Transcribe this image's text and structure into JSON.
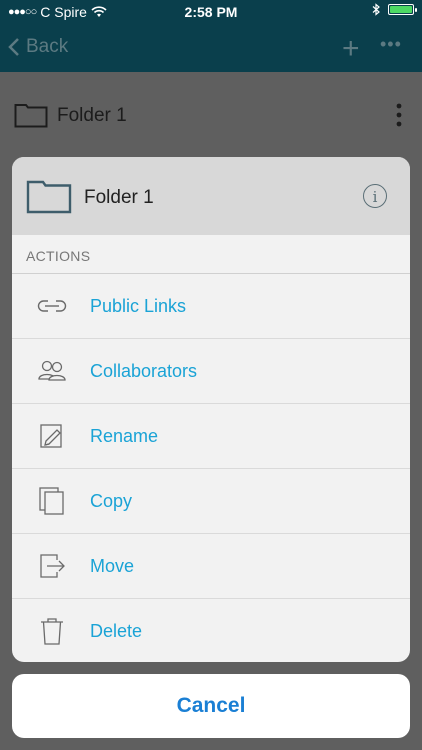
{
  "status_bar": {
    "carrier": "C Spire",
    "time": "2:58 PM",
    "battery_level": 1.0
  },
  "nav": {
    "back_label": "Back"
  },
  "background_row": {
    "folder_name": "Folder 1"
  },
  "sheet": {
    "header_title": "Folder 1",
    "section_title": "ACTIONS",
    "actions": [
      {
        "label": "Public Links",
        "icon": "link-icon"
      },
      {
        "label": "Collaborators",
        "icon": "people-icon"
      },
      {
        "label": "Rename",
        "icon": "rename-icon"
      },
      {
        "label": "Copy",
        "icon": "copy-icon"
      },
      {
        "label": "Move",
        "icon": "move-icon"
      },
      {
        "label": "Delete",
        "icon": "trash-icon"
      }
    ]
  },
  "cancel_label": "Cancel",
  "colors": {
    "accent": "#1aa3d6",
    "cancel": "#1a7fd4",
    "navbar": "#0a3f4c"
  }
}
